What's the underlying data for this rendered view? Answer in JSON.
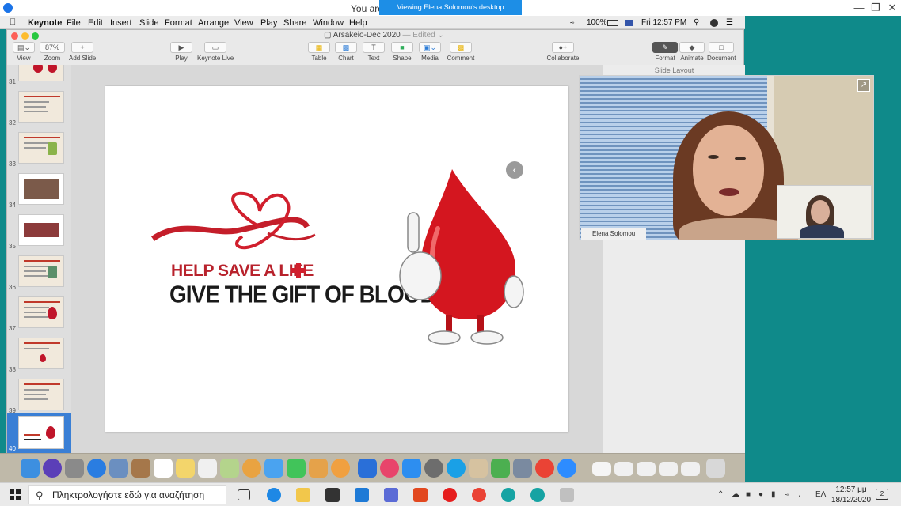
{
  "host": {
    "title": "You are",
    "banner": "Viewing Elena Solomou's desktop"
  },
  "mac_menubar": {
    "app_name": "Keynote",
    "menus": [
      "File",
      "Edit",
      "Insert",
      "Slide",
      "Format",
      "Arrange",
      "View",
      "Play",
      "Share",
      "Window",
      "Help"
    ],
    "battery": "100%",
    "datetime": "Fri 12:57 PM"
  },
  "keynote": {
    "doc_title": "Arsakeio-Dec 2020",
    "doc_status": "Edited",
    "zoom": "87%",
    "toolbar": {
      "view": "View",
      "zoom": "Zoom",
      "add_slide": "Add Slide",
      "play": "Play",
      "keynote_live": "Keynote Live",
      "table": "Table",
      "chart": "Chart",
      "text": "Text",
      "shape": "Shape",
      "media": "Media",
      "comment": "Comment",
      "collaborate": "Collaborate",
      "format": "Format",
      "animate": "Animate",
      "document": "Document"
    },
    "slide_numbers": [
      "31",
      "32",
      "33",
      "34",
      "35",
      "36",
      "37",
      "38",
      "39",
      "40"
    ],
    "inspector_title": "Slide Layout",
    "slide": {
      "line1": "HELP SAVE A LIFE",
      "line2": "GIVE THE GIFT OF BLOOD"
    }
  },
  "video": {
    "presenter_name": "Elena Solomou"
  },
  "taskbar": {
    "search_placeholder": "Πληκτρολογήστε εδώ για αναζήτηση",
    "language": "ΕΛ",
    "time": "12:57 μμ",
    "date": "18/12/2020",
    "notifications": "2"
  },
  "colors": {
    "accent_blue": "#1d8ee6",
    "slide_red": "#b8222c",
    "teal_bg": "#0f8a8a"
  }
}
